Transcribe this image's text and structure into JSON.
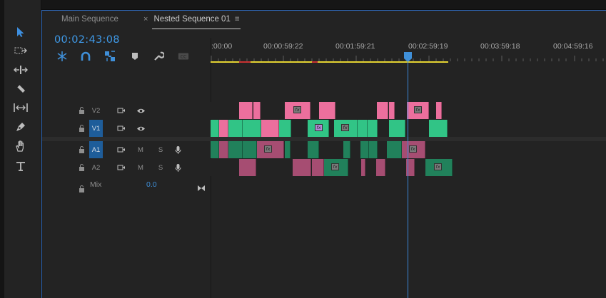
{
  "panel": {
    "tabs": [
      {
        "label": "Main Sequence"
      },
      {
        "label": "Nested Sequence 01",
        "close": "×",
        "menu": "≡"
      }
    ],
    "timecode": "00:02:43:08"
  },
  "ruler": {
    "labels": [
      ":00:00",
      "00:00:59:22",
      "00:01:59:21",
      "00:02:59:19",
      "00:03:59:18",
      "00:04:59:16"
    ]
  },
  "tracks": {
    "v2": {
      "name": "V2"
    },
    "v1": {
      "name": "V1"
    },
    "a1": {
      "name": "A1",
      "mute": "M",
      "solo": "S"
    },
    "a2": {
      "name": "A2",
      "mute": "M",
      "solo": "S"
    },
    "mix": {
      "label": "Mix",
      "value": "0.0"
    }
  },
  "tools": [
    "selection-tool",
    "track-select-tool",
    "ripple-edit-tool",
    "razor-tool",
    "slip-tool",
    "pen-tool",
    "hand-tool",
    "type-tool"
  ],
  "controls": [
    "insert-nest-icon",
    "snap-icon",
    "linked-selection-icon",
    "add-marker-icon",
    "settings-wrench-icon",
    "captions-icon"
  ],
  "colors": {
    "accent": "#3f9ae8",
    "video_pink": "#ec6f9d",
    "video_green": "#31c486",
    "audio_pink": "#a64d72",
    "audio_green": "#21815b",
    "work_area": "#e3d232"
  }
}
